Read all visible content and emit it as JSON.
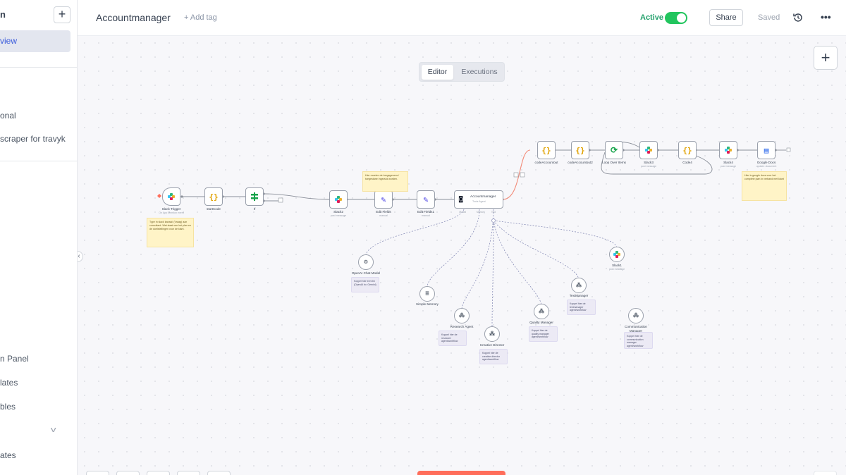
{
  "sidebar": {
    "title": "n",
    "plus_label": "+",
    "active_item": "view",
    "items": [
      {
        "label": "onal"
      },
      {
        "label": "scraper for travyk"
      },
      {
        "label": "n Panel"
      },
      {
        "label": "lates"
      },
      {
        "label": "bles"
      },
      {
        "label": "ates"
      }
    ]
  },
  "header": {
    "workflow_name": "Accountmanager",
    "add_tag": "+ Add tag",
    "active_label": "Active",
    "share_label": "Share",
    "saved_label": "Saved",
    "more_label": "•••"
  },
  "tabs": [
    {
      "label": "Editor",
      "selected": true
    },
    {
      "label": "Executions",
      "selected": false
    }
  ],
  "canvas": {
    "add_node_label": "+",
    "nodes": [
      {
        "id": "slack-trigger",
        "label": "Slack Trigger",
        "sub": "On App Mention event",
        "icon": "slack-icon"
      },
      {
        "id": "startcode",
        "label": "startCode",
        "sub": "",
        "icon": "code-icon"
      },
      {
        "id": "if",
        "label": "If",
        "sub": "",
        "icon": "if-icon"
      },
      {
        "id": "slack2",
        "label": "Slack2",
        "sub": "post message",
        "icon": "slack-icon"
      },
      {
        "id": "edit-fields",
        "label": "Edit Fields",
        "sub": "manual",
        "icon": "pencil-icon"
      },
      {
        "id": "edit-fields1",
        "label": "Edit Fields1",
        "sub": "manual",
        "icon": "pencil-icon"
      },
      {
        "id": "accountmanager",
        "label": "Accountmanager",
        "sub": "Tools Agent",
        "icon": "robot-icon"
      },
      {
        "id": "codeAccount",
        "label": "codeAccountout",
        "sub": "",
        "icon": "code-icon"
      },
      {
        "id": "codeAccount2",
        "label": "codeAccountout2",
        "sub": "",
        "icon": "code-icon"
      },
      {
        "id": "loop",
        "label": "Loop Over Items",
        "sub": "",
        "icon": "loop-icon"
      },
      {
        "id": "slack3",
        "label": "Slack3",
        "sub": "post message",
        "icon": "slack-icon"
      },
      {
        "id": "code4",
        "label": "Code4",
        "sub": "",
        "icon": "code-icon"
      },
      {
        "id": "slack4",
        "label": "Slack4",
        "sub": "post message",
        "icon": "slack-icon"
      },
      {
        "id": "google-docs",
        "label": "Google Docs",
        "sub": "update: document",
        "icon": "google-docs-icon"
      },
      {
        "id": "openai",
        "label": "OpenAI Chat Model",
        "sub": "",
        "icon": "openai-icon"
      },
      {
        "id": "memory",
        "label": "Simple Memory",
        "sub": "",
        "icon": "database-icon"
      },
      {
        "id": "research",
        "label": "Research Agent",
        "sub": "",
        "icon": "tool-icon"
      },
      {
        "id": "creative",
        "label": "Creative Director",
        "sub": "",
        "icon": "tool-icon"
      },
      {
        "id": "quality",
        "label": "Quality Manager",
        "sub": "",
        "icon": "tool-icon"
      },
      {
        "id": "text",
        "label": "TextManager",
        "sub": "",
        "icon": "tool-icon"
      },
      {
        "id": "slack1",
        "label": "Slack1",
        "sub": "post message",
        "icon": "slack-icon"
      },
      {
        "id": "comm",
        "label": "Communication Manager",
        "sub": "",
        "icon": "tool-icon"
      }
    ],
    "stickies": [
      {
        "text": "Type in slack kanaal: (Vraag) aan consultant. Wat staat van het plan en de doelstellingen voor de klant."
      },
      {
        "text": "Hier moeten de toegegevens / toegestane ingevuld worden."
      },
      {
        "text": "Hier is google docs voor het complete plan in verband met klant"
      }
    ],
    "notes": [
      {
        "text": "Koppel hier een llm (OpenAI bv. Gemini)"
      },
      {
        "text": "Koppel hier de research agent/workflow"
      },
      {
        "text": "Koppel hier de creative director agent/workflow"
      },
      {
        "text": "Koppel hier de quality manager agent/workflow"
      },
      {
        "text": "Koppel hier de textmanager agent/workflow"
      },
      {
        "text": "Koppel hier de communication manager agent/workflow"
      }
    ],
    "port_labels": {
      "model": "Model",
      "memory": "Memory",
      "tool": "Tool"
    }
  }
}
